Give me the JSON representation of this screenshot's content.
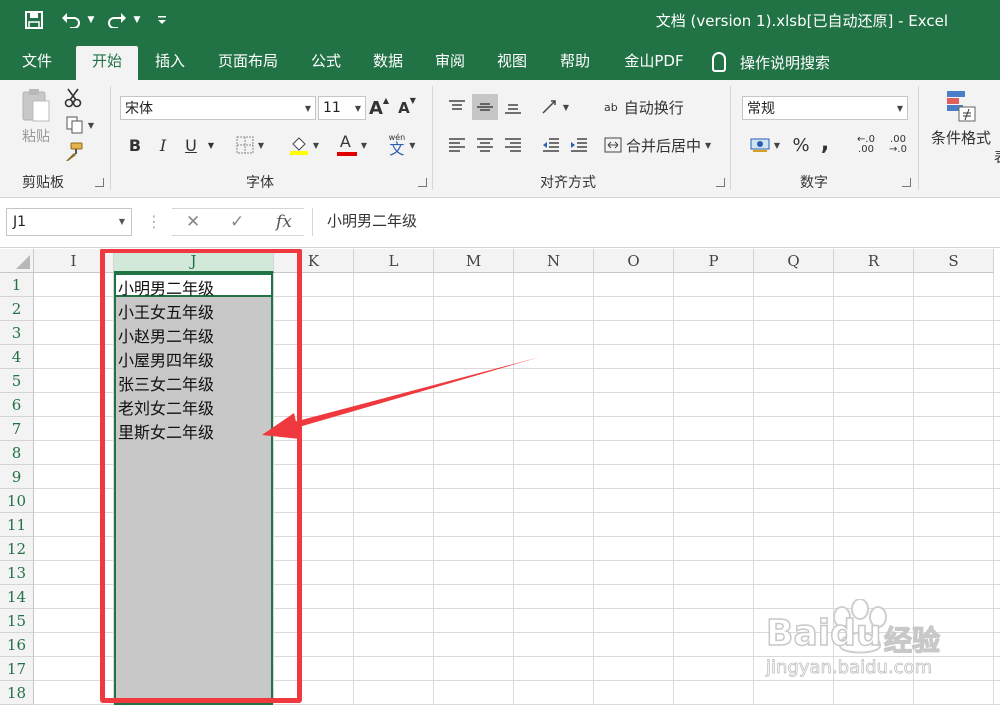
{
  "window": {
    "title": "文档 (version 1).xlsb[已自动还原]  -  Excel"
  },
  "ribbon_tabs": [
    "文件",
    "开始",
    "插入",
    "页面布局",
    "公式",
    "数据",
    "审阅",
    "视图",
    "帮助",
    "金山PDF"
  ],
  "active_tab": "开始",
  "tell_me": "操作说明搜索",
  "ribbon": {
    "clipboard": {
      "label": "剪贴板",
      "paste": "粘贴"
    },
    "font": {
      "label": "字体",
      "font_name": "宋体",
      "font_size": "11",
      "bold": "B",
      "italic": "I",
      "underline": "U",
      "grow": "A",
      "shrink": "A",
      "phonetic_top": "wén",
      "phonetic": "文",
      "font_color_glyph": "A"
    },
    "alignment": {
      "label": "对齐方式",
      "wrap_text": "自动换行",
      "merge_center": "合并后居中",
      "wrap_glyph": "ab"
    },
    "number": {
      "label": "数字",
      "format": "常规",
      "percent": "%",
      "comma": ",",
      "increase_decimal": "←.0\n.00",
      "decrease_decimal": ".00\n→.0"
    },
    "styles": {
      "conditional_format": "条件格式",
      "cut_off_text": "表"
    }
  },
  "formula_bar": {
    "name_box": "J1",
    "fx": "fx",
    "content": "小明男二年级"
  },
  "sheet": {
    "columns": [
      "I",
      "J",
      "K",
      "L",
      "M",
      "N",
      "O",
      "P",
      "Q",
      "R",
      "S"
    ],
    "selected_column": "J",
    "rows": [
      "1",
      "2",
      "3",
      "4",
      "5",
      "6",
      "7",
      "8",
      "9",
      "10",
      "11",
      "12",
      "13",
      "14",
      "15",
      "16",
      "17",
      "18"
    ],
    "j_values": [
      "小明男二年级",
      "小王女五年级",
      "小赵男二年级",
      "小屋男四年级",
      "张三女二年级",
      "老刘女二年级",
      "里斯女二年级"
    ]
  },
  "watermark": {
    "brand": "Baidu",
    "brand_cn": "经验",
    "url": "jingyan.baidu.com"
  },
  "colors": {
    "excel_green": "#217346",
    "selection_gray": "#c8c8c8",
    "annotation_red": "#f0393e"
  }
}
